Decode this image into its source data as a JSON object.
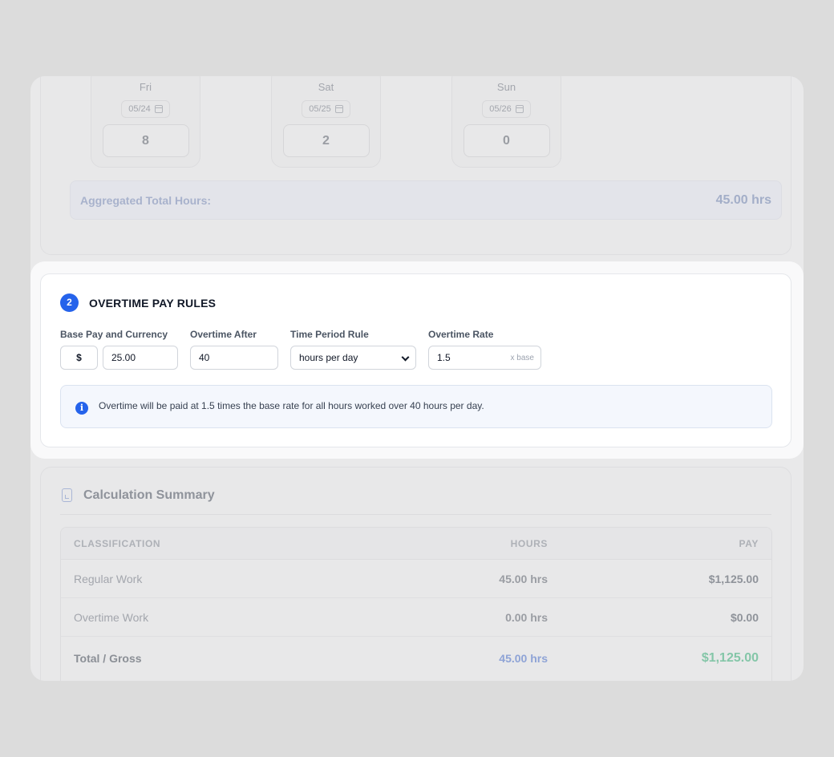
{
  "hours": {
    "days": [
      {
        "name": "Fri",
        "date": "05/24",
        "value": "8"
      },
      {
        "name": "Sat",
        "date": "05/25",
        "value": "2"
      },
      {
        "name": "Sun",
        "date": "05/26",
        "value": "0"
      }
    ],
    "aggregate_label": "Aggregated Total Hours:",
    "aggregate_value": "45.00 hrs"
  },
  "overtime": {
    "step": "2",
    "title": "OVERTIME PAY RULES",
    "base_pay_label": "Base Pay and Currency",
    "currency": "$",
    "base_pay": "25.00",
    "overtime_after_label": "Overtime After",
    "overtime_after": "40",
    "period_label": "Time Period Rule",
    "period": "hours per day",
    "rate_label": "Overtime Rate",
    "rate": "1.5",
    "rate_suffix": "x base",
    "notice": "Overtime will be paid at 1.5 times the base rate for all hours worked over 40 hours per day."
  },
  "summary": {
    "title": "Calculation Summary",
    "headers": {
      "classification": "CLASSIFICATION",
      "hours": "HOURS",
      "pay": "PAY"
    },
    "rows": [
      {
        "classification": "Regular Work",
        "hours": "45.00 hrs",
        "pay": "$1,125.00"
      },
      {
        "classification": "Overtime Work",
        "hours": "0.00 hrs",
        "pay": "$0.00"
      }
    ],
    "total": {
      "classification": "Total / Gross",
      "hours": "45.00 hrs",
      "pay": "$1,125.00"
    }
  },
  "colors": {
    "accent": "#2563eb",
    "total_pay": "#84c6a8",
    "total_hours": "#8ea3d6"
  }
}
